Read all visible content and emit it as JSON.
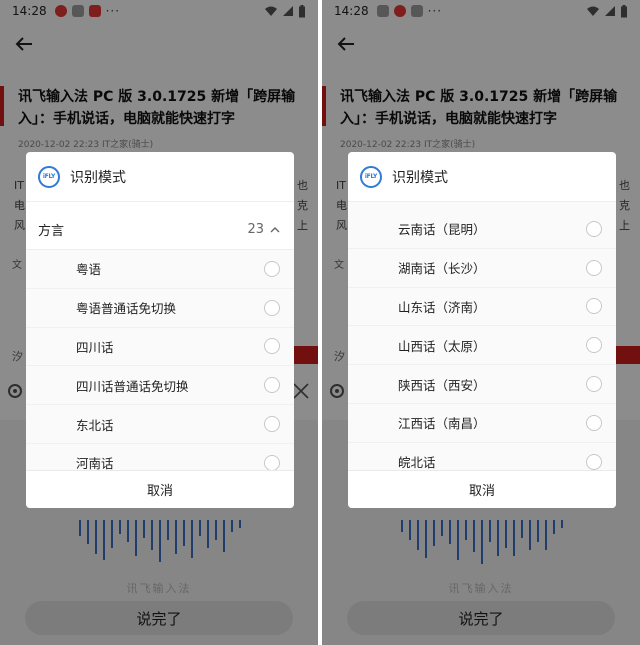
{
  "left": {
    "status": {
      "time": "14:28",
      "dots": "···"
    },
    "article": {
      "title": "讯飞输入法 PC 版 3.0.1725 新增「跨屏输入」：手机说话，电脑就能快速打字",
      "meta": "2020-12-02 22:23   IT之家(骑士)",
      "body_left": [
        "IT",
        "电",
        "风"
      ],
      "body_right": [
        "也",
        "克",
        "上"
      ]
    },
    "voice": {
      "done_label": "说完了",
      "watermark": "讯飞输入法"
    },
    "dialog": {
      "title": "识别模式",
      "logo_text": "iFLY",
      "category": {
        "label": "方言",
        "count": "23"
      },
      "items": [
        {
          "label": "粤语"
        },
        {
          "label": "粤语普通话免切换"
        },
        {
          "label": "四川话"
        },
        {
          "label": "四川话普通话免切换"
        },
        {
          "label": "东北话"
        },
        {
          "label": "河南话"
        }
      ],
      "cancel_label": "取消"
    },
    "side_labels": {
      "wen": "文",
      "sha": "汐"
    }
  },
  "right": {
    "status": {
      "time": "14:28",
      "dots": "···"
    },
    "article": {
      "title": "讯飞输入法 PC 版 3.0.1725 新增「跨屏输入」：手机说话，电脑就能快速打字",
      "meta": "2020-12-02 22:23   IT之家(骑士)",
      "body_left": [
        "IT",
        "电",
        "风"
      ],
      "body_right": [
        "也",
        "克",
        "上"
      ]
    },
    "voice": {
      "done_label": "说完了",
      "watermark": "讯飞输入法"
    },
    "dialog": {
      "title": "识别模式",
      "logo_text": "iFLY",
      "items": [
        {
          "label": "云南话（昆明）"
        },
        {
          "label": "湖南话（长沙）"
        },
        {
          "label": "山东话（济南）"
        },
        {
          "label": "山西话（太原）"
        },
        {
          "label": "陕西话（西安）"
        },
        {
          "label": "江西话（南昌）"
        },
        {
          "label": "皖北话"
        }
      ],
      "cancel_label": "取消"
    },
    "side_labels": {
      "wen": "文",
      "sha": "汐"
    }
  },
  "colors": {
    "accent": "#2f7bd6",
    "title_bar": "#d01c1c"
  }
}
